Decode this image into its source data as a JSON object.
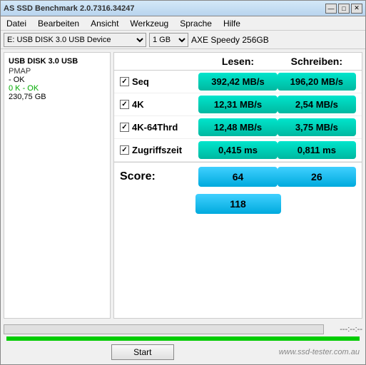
{
  "window": {
    "title": "AS SSD Benchmark 2.0.7316.34247",
    "buttons": {
      "minimize": "—",
      "maximize": "□",
      "close": "✕"
    }
  },
  "menu": {
    "items": [
      "Datei",
      "Bearbeiten",
      "Ansicht",
      "Werkzeug",
      "Sprache",
      "Hilfe"
    ]
  },
  "toolbar": {
    "drive": "E: USB DISK 3.0 USB Device",
    "size": "1 GB",
    "label": "AXE Speedy 256GB"
  },
  "left_panel": {
    "device_name": "USB DISK 3.0 USB",
    "pmap": "PMAP",
    "ok1": "- OK",
    "ok2": "0 K - OK",
    "capacity": "230,75 GB"
  },
  "headers": {
    "col1": "",
    "col2": "Lesen:",
    "col3": "Schreiben:"
  },
  "rows": [
    {
      "label": "Seq",
      "read": "392,42 MB/s",
      "write": "196,20 MB/s"
    },
    {
      "label": "4K",
      "read": "12,31 MB/s",
      "write": "2,54 MB/s"
    },
    {
      "label": "4K-64Thrd",
      "read": "12,48 MB/s",
      "write": "3,75 MB/s"
    },
    {
      "label": "Zugriffszeit",
      "read": "0,415 ms",
      "write": "0,811 ms"
    }
  ],
  "score": {
    "label": "Score:",
    "read": "64",
    "write": "26",
    "total": "118"
  },
  "bottom": {
    "progress_time": "---:--:--",
    "start_btn": "Start",
    "watermark": "www.ssd-tester.com.au"
  }
}
